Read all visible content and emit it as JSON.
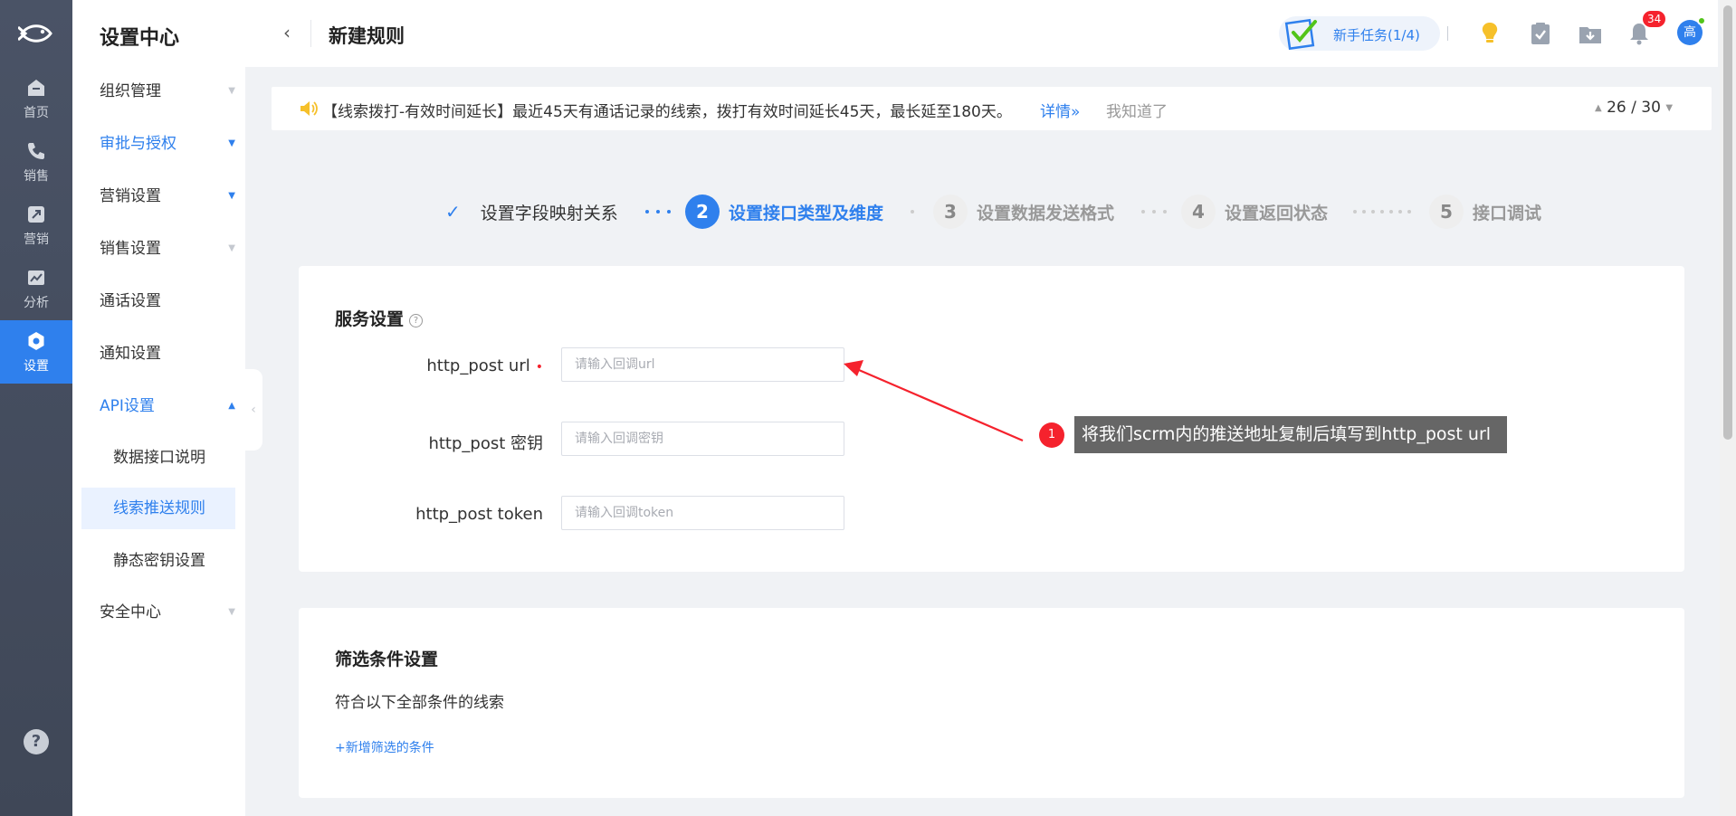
{
  "rail": {
    "items": [
      {
        "label": "首页",
        "icon": "home-icon"
      },
      {
        "label": "销售",
        "icon": "phone-icon"
      },
      {
        "label": "营销",
        "icon": "share-icon"
      },
      {
        "label": "分析",
        "icon": "chart-icon"
      },
      {
        "label": "设置",
        "icon": "settings-icon",
        "active": true
      }
    ],
    "help_label": "?"
  },
  "submenu": {
    "title": "设置中心",
    "items": [
      {
        "label": "组织管理"
      },
      {
        "label": "审批与授权"
      },
      {
        "label": "营销设置"
      },
      {
        "label": "销售设置"
      },
      {
        "label": "通话设置"
      },
      {
        "label": "通知设置"
      },
      {
        "label": "API设置"
      },
      {
        "label": "数据接口说明"
      },
      {
        "label": "线索推送规则"
      },
      {
        "label": "静态密钥设置"
      },
      {
        "label": "安全中心"
      }
    ]
  },
  "topbar": {
    "back": "‹",
    "title": "新建规则",
    "task_label": "新手任务(1/4)",
    "badge": "34",
    "avatar": "高"
  },
  "notice": {
    "text": "【线索拨打-有效时间延长】最近45天有通话记录的线索，拨打有效时间延长45天，最长延至180天。",
    "detail": "详情»",
    "dismiss": "我知道了",
    "pager": "26 / 30"
  },
  "steps": [
    {
      "label": "设置字段映射关系",
      "state": "done"
    },
    {
      "num": "2",
      "label": "设置接口类型及维度",
      "state": "active"
    },
    {
      "num": "3",
      "label": "设置数据发送格式",
      "state": "todo"
    },
    {
      "num": "4",
      "label": "设置返回状态",
      "state": "todo"
    },
    {
      "num": "5",
      "label": "接口调试",
      "state": "todo"
    }
  ],
  "service": {
    "title": "服务设置",
    "help": "?",
    "fields": [
      {
        "label": "http_post url",
        "required": "•",
        "placeholder": "请输入回调url"
      },
      {
        "label": "http_post 密钥",
        "placeholder": "请输入回调密钥"
      },
      {
        "label": "http_post token",
        "placeholder": "请输入回调token"
      }
    ]
  },
  "filter": {
    "title": "筛选条件设置",
    "subtitle": "符合以下全部条件的线索",
    "add_label": "+新增筛选的条件"
  },
  "annotation": {
    "num": "1",
    "text": "将我们scrm内的推送地址复制后填写到http_post url",
    "color": "#f5222d"
  },
  "colors": {
    "accent": "#2f80ed",
    "rail_bg": "#4a5366"
  }
}
